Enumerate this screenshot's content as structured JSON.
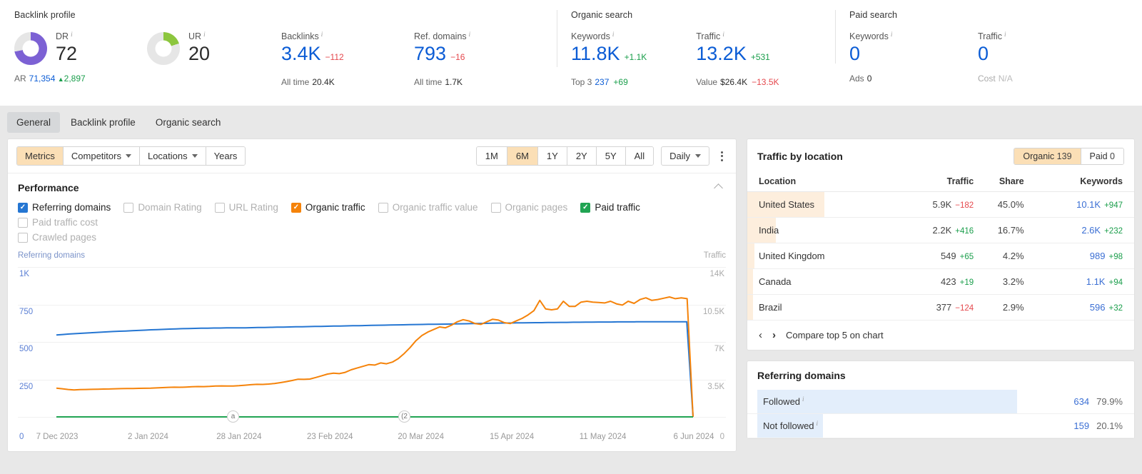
{
  "overview": {
    "groups": [
      {
        "title": "Backlink profile",
        "metrics": [
          {
            "label": "DR",
            "value": "72",
            "donut": "purple",
            "pct": 72,
            "sub_label": "AR",
            "sub_value": "71,354",
            "sub_delta": "2,897",
            "sub_delta_dir": "up"
          },
          {
            "label": "UR",
            "value": "20",
            "donut": "green",
            "pct": 20
          },
          {
            "label": "Backlinks",
            "value": "3.4K",
            "delta": "−112",
            "delta_dir": "neg",
            "sub_label": "All time",
            "sub_value": "20.4K"
          },
          {
            "label": "Ref. domains",
            "value": "793",
            "delta": "−16",
            "delta_dir": "neg",
            "sub_label": "All time",
            "sub_value": "1.7K"
          }
        ]
      },
      {
        "title": "Organic search",
        "metrics": [
          {
            "label": "Keywords",
            "value": "11.8K",
            "delta": "+1.1K",
            "delta_dir": "pos",
            "sub_label": "Top 3",
            "sub_value": "237",
            "sub_delta": "+69",
            "sub_delta_dir": "pos"
          },
          {
            "label": "Traffic",
            "value": "13.2K",
            "delta": "+531",
            "delta_dir": "pos",
            "sub_label": "Value",
            "sub_value": "$26.4K",
            "sub_delta": "−13.5K",
            "sub_delta_dir": "neg"
          }
        ]
      },
      {
        "title": "Paid search",
        "metrics": [
          {
            "label": "Keywords",
            "value": "0",
            "sub_label": "Ads",
            "sub_value": "0"
          },
          {
            "label": "Traffic",
            "value": "0",
            "sub_label": "Cost",
            "sub_value": "N/A",
            "sub_muted": true
          }
        ]
      }
    ]
  },
  "tabs": [
    {
      "label": "General",
      "active": true
    },
    {
      "label": "Backlink profile",
      "active": false
    },
    {
      "label": "Organic search",
      "active": false
    }
  ],
  "chart_toolbar": {
    "left_buttons": [
      {
        "label": "Metrics",
        "selected": true,
        "caret": false
      },
      {
        "label": "Competitors",
        "selected": false,
        "caret": true
      },
      {
        "label": "Locations",
        "selected": false,
        "caret": true
      },
      {
        "label": "Years",
        "selected": false,
        "caret": false
      }
    ],
    "ranges": [
      {
        "label": "1M",
        "selected": false
      },
      {
        "label": "6M",
        "selected": true
      },
      {
        "label": "1Y",
        "selected": false
      },
      {
        "label": "2Y",
        "selected": false
      },
      {
        "label": "5Y",
        "selected": false
      },
      {
        "label": "All",
        "selected": false
      }
    ],
    "granularity": "Daily"
  },
  "performance": {
    "title": "Performance",
    "legend": [
      {
        "label": "Referring domains",
        "checked": true,
        "color": "blue"
      },
      {
        "label": "Domain Rating",
        "checked": false
      },
      {
        "label": "URL Rating",
        "checked": false
      },
      {
        "label": "Organic traffic",
        "checked": true,
        "color": "orange"
      },
      {
        "label": "Organic traffic value",
        "checked": false
      },
      {
        "label": "Organic pages",
        "checked": false
      },
      {
        "label": "Paid traffic",
        "checked": true,
        "color": "green"
      },
      {
        "label": "Paid traffic cost",
        "checked": false
      },
      {
        "label": "Crawled pages",
        "checked": false
      }
    ]
  },
  "chart_data": {
    "type": "line",
    "title": "Performance",
    "ylabel": "Referring domains",
    "ylabel_right": "Traffic",
    "xlabel": "",
    "ylim": [
      0,
      1250
    ],
    "ylim_right": [
      0,
      17500
    ],
    "yticks_left": [
      "0",
      "250",
      "500",
      "750",
      "1K"
    ],
    "yticks_right": [
      "0",
      "3.5K",
      "7K",
      "10.5K",
      "14K"
    ],
    "grid": true,
    "legend_position": "top",
    "x_tick_labels": [
      "7 Dec 2023",
      "2 Jan 2024",
      "28 Jan 2024",
      "23 Feb 2024",
      "20 Mar 2024",
      "15 Apr 2024",
      "11 May 2024",
      "6 Jun 2024"
    ],
    "annotations": [
      {
        "label": "a",
        "x_frac": 0.277
      },
      {
        "label": "(2",
        "x_frac": 0.546
      }
    ],
    "series": [
      {
        "name": "Referring domains",
        "color": "#2576d2",
        "axis": "left",
        "values": [
          683,
          687,
          691,
          694,
          697,
          700,
          703,
          706,
          709,
          712,
          714,
          716,
          719,
          721,
          723,
          726,
          728,
          730,
          732,
          734,
          736,
          737,
          738,
          739,
          740,
          741,
          741,
          742,
          742,
          743,
          743,
          744,
          745,
          746,
          747,
          748,
          749,
          750,
          751,
          752,
          753,
          754,
          755,
          756,
          757,
          758,
          759,
          760,
          761,
          762,
          763,
          764,
          765,
          766,
          767,
          768,
          769,
          770,
          771,
          772,
          772,
          773,
          774,
          775,
          776,
          777,
          778,
          779,
          780,
          781,
          782,
          783,
          783,
          784,
          784,
          785,
          786,
          786,
          787,
          787,
          788,
          788,
          789,
          789,
          790,
          790,
          791,
          791,
          791,
          792,
          792,
          792,
          793,
          793,
          793,
          793,
          793,
          793,
          793,
          793,
          793,
          0
        ]
      },
      {
        "name": "Organic traffic",
        "color": "#f5830a",
        "axis": "right",
        "values": [
          3350,
          3280,
          3200,
          3150,
          3180,
          3200,
          3220,
          3230,
          3250,
          3260,
          3280,
          3300,
          3310,
          3320,
          3330,
          3340,
          3350,
          3380,
          3420,
          3450,
          3470,
          3460,
          3480,
          3520,
          3540,
          3530,
          3560,
          3600,
          3620,
          3610,
          3600,
          3640,
          3700,
          3760,
          3800,
          3790,
          3830,
          3900,
          4000,
          4120,
          4250,
          4400,
          4380,
          4420,
          4600,
          4800,
          5000,
          5100,
          5050,
          5200,
          5500,
          5700,
          5900,
          6100,
          6050,
          6300,
          6200,
          6400,
          6800,
          7400,
          8100,
          8900,
          9500,
          9900,
          10200,
          10500,
          10400,
          10700,
          11100,
          11350,
          11200,
          10900,
          10800,
          11100,
          11400,
          11300,
          11000,
          10900,
          11200,
          11500,
          11900,
          12400,
          13600,
          12600,
          12500,
          12600,
          13500,
          12900,
          12900,
          13400,
          13500,
          13400,
          13350,
          13300,
          13500,
          13200,
          13050,
          13500,
          13250,
          13700,
          13900,
          13600,
          13700,
          13850,
          14000,
          13800,
          13900,
          13800,
          0
        ]
      },
      {
        "name": "Paid traffic",
        "color": "#21a453",
        "axis": "right",
        "values": [
          0,
          0,
          0,
          0,
          0,
          0,
          0,
          0,
          0,
          0,
          0,
          0,
          0,
          0,
          0,
          0,
          0,
          0,
          0,
          0,
          0,
          0,
          0,
          0,
          0,
          0,
          0,
          0,
          0,
          0,
          0,
          0,
          0,
          0,
          0,
          0,
          0,
          0,
          0,
          0,
          0,
          0,
          0,
          0,
          0,
          0,
          0,
          0,
          0,
          0,
          0,
          0,
          0,
          0,
          0,
          0,
          0,
          0,
          0,
          0,
          0,
          0,
          0,
          0,
          0,
          0,
          0,
          0,
          0,
          0,
          0,
          0,
          0,
          0,
          0,
          0,
          0,
          0,
          0,
          0,
          0,
          0,
          0,
          0,
          0,
          0,
          0,
          0,
          0,
          0,
          0,
          0,
          0,
          0,
          0,
          0,
          0,
          0,
          0,
          0,
          0,
          0
        ]
      }
    ]
  },
  "traffic_by_location": {
    "title": "Traffic by location",
    "toggle": [
      {
        "label": "Organic",
        "count": "139",
        "selected": true
      },
      {
        "label": "Paid",
        "count": "0",
        "selected": false
      }
    ],
    "columns": [
      "Location",
      "Traffic",
      "Share",
      "Keywords"
    ],
    "rows": [
      {
        "location": "United States",
        "traffic": "5.9K",
        "traffic_delta": "−182",
        "traffic_delta_dir": "neg",
        "share": "45.0%",
        "keywords": "10.1K",
        "keywords_delta": "+947",
        "keywords_delta_dir": "pos",
        "bar_pct": 45.0
      },
      {
        "location": "India",
        "traffic": "2.2K",
        "traffic_delta": "+416",
        "traffic_delta_dir": "pos",
        "share": "16.7%",
        "keywords": "2.6K",
        "keywords_delta": "+232",
        "keywords_delta_dir": "pos",
        "bar_pct": 16.7
      },
      {
        "location": "United Kingdom",
        "traffic": "549",
        "traffic_delta": "+65",
        "traffic_delta_dir": "pos",
        "share": "4.2%",
        "keywords": "989",
        "keywords_delta": "+98",
        "keywords_delta_dir": "pos",
        "bar_pct": 4.2
      },
      {
        "location": "Canada",
        "traffic": "423",
        "traffic_delta": "+19",
        "traffic_delta_dir": "pos",
        "share": "3.2%",
        "keywords": "1.1K",
        "keywords_delta": "+94",
        "keywords_delta_dir": "pos",
        "bar_pct": 3.2
      },
      {
        "location": "Brazil",
        "traffic": "377",
        "traffic_delta": "−124",
        "traffic_delta_dir": "neg",
        "share": "2.9%",
        "keywords": "596",
        "keywords_delta": "+32",
        "keywords_delta_dir": "pos",
        "bar_pct": 2.9
      }
    ],
    "footer_link": "Compare top 5 on chart",
    "prev_icon": "chevron-left-icon",
    "next_icon": "chevron-right-icon"
  },
  "referring_domains_panel": {
    "title": "Referring domains",
    "rows": [
      {
        "label": "Followed",
        "count": "634",
        "pct": "79.9%",
        "bar_pct": 79.9
      },
      {
        "label": "Not followed",
        "count": "159",
        "pct": "20.1%",
        "bar_pct": 20.1
      }
    ]
  },
  "colors": {
    "accent_orange": "#f5830a",
    "highlight": "#fbdfb6",
    "blue": "#2576d2",
    "green": "#21a453",
    "purple": "#7c61d4",
    "positive": "#1a9e4b",
    "negative": "#e5484d",
    "link_blue": "#0b5cd5"
  }
}
